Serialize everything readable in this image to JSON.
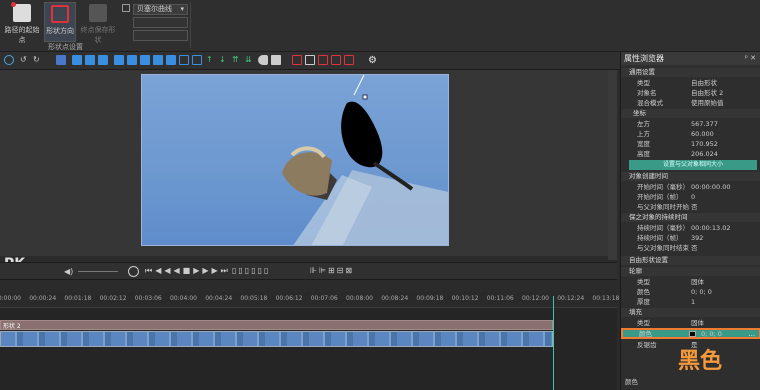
{
  "ribbon": {
    "buttons": [
      "路径的起始点",
      "形状方向",
      "终点保存形状"
    ],
    "group_label": "形状点设置",
    "select_value": "贝塞尔曲线"
  },
  "panel": {
    "title": "属性浏览器",
    "pin": "ᵖ ✕",
    "general_header": "通用设置",
    "rows_general": [
      [
        "类型",
        "自由形状"
      ],
      [
        "对象名",
        "自由形状 2"
      ],
      [
        "混合模式",
        "使用原始值"
      ]
    ],
    "coords_header": "坐标",
    "rows_coords": [
      [
        "左方",
        "567.377"
      ],
      [
        "上方",
        "60.000"
      ],
      [
        "宽度",
        "170.952"
      ],
      [
        "高度",
        "206.024"
      ]
    ],
    "coords_button": "设置与父对象相同大小",
    "create_header": "对象创建时间",
    "rows_create": [
      [
        "开始时间（毫秒）",
        "00:00:00.00"
      ],
      [
        "开始时间（帧）",
        "0"
      ],
      [
        "与父对象同时开始",
        "否"
      ]
    ],
    "dur_header": "保之对象的持续时间",
    "rows_dur": [
      [
        "持续时间（毫秒）",
        "00:00:13.02"
      ],
      [
        "持续时间（帧）",
        "392"
      ],
      [
        "与父对象同时结束",
        "否"
      ]
    ],
    "shape_header": "自由形状设置",
    "line_header": "轮廓",
    "rows_line": [
      [
        "类型",
        "固体"
      ],
      [
        "颜色",
        "0; 0; 0"
      ],
      [
        "厚度",
        "1"
      ]
    ],
    "fill_header": "填充",
    "fill_type": [
      "类型",
      "固体"
    ],
    "fill_color": [
      "颜色",
      "0; 0; 0"
    ],
    "rows_fill_extra": [
      [
        "反锯齿",
        "是"
      ]
    ],
    "footer_label": "颜色"
  },
  "annotation": "黑色",
  "timeline": {
    "ticks": [
      "00:00:00",
      "00:00:24",
      "00:01:18",
      "00:02:12",
      "00:03:06",
      "00:04:00",
      "00:04:24",
      "00:05:18",
      "00:06:12",
      "00:07:06",
      "00:08:00",
      "00:08:24",
      "00:09:18",
      "00:10:12",
      "00:11:06",
      "00:12:00",
      "00:12:24",
      "00:13:18",
      "00:14:12"
    ],
    "shape_clip": "形状 2"
  },
  "brand": "PK"
}
